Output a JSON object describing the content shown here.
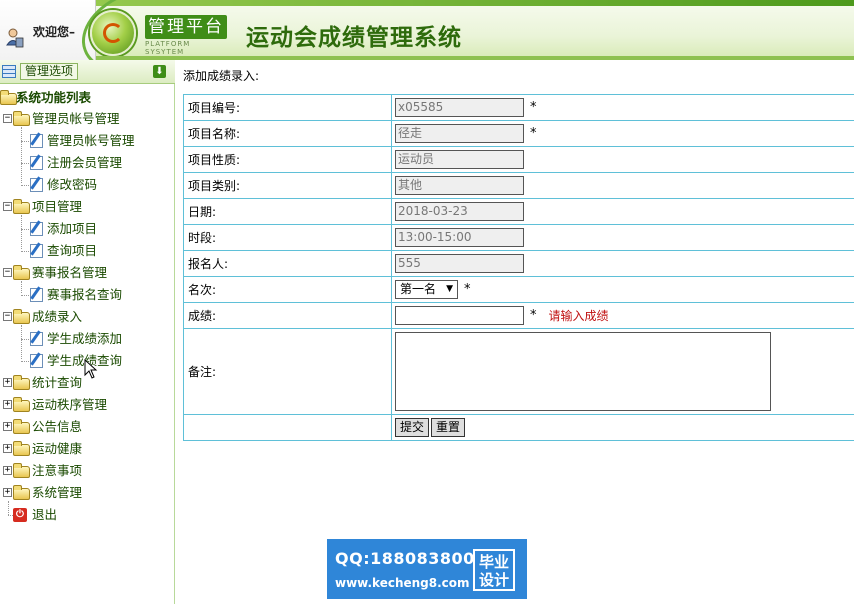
{
  "header": {
    "welcome": "欢迎您–",
    "badge_title": "管理平台",
    "badge_subtitle": "PLATFORM SYSYTEM",
    "system_title": "运动会成绩管理系统"
  },
  "sidebar": {
    "header_label": "管理选项",
    "tree_title": "系统功能列表",
    "groups": [
      {
        "label": "管理员帐号管理",
        "expanded": true,
        "items": [
          "管理员帐号管理",
          "注册会员管理",
          "修改密码"
        ]
      },
      {
        "label": "项目管理",
        "expanded": true,
        "items": [
          "添加项目",
          "查询项目"
        ]
      },
      {
        "label": "赛事报名管理",
        "expanded": true,
        "items": [
          "赛事报名查询"
        ]
      },
      {
        "label": "成绩录入",
        "expanded": true,
        "items": [
          "学生成绩添加",
          "学生成绩查询"
        ]
      },
      {
        "label": "统计查询",
        "expanded": false,
        "items": []
      },
      {
        "label": "运动秩序管理",
        "expanded": false,
        "items": []
      },
      {
        "label": "公告信息",
        "expanded": false,
        "items": []
      },
      {
        "label": "运动健康",
        "expanded": false,
        "items": []
      },
      {
        "label": "注意事项",
        "expanded": false,
        "items": []
      },
      {
        "label": "系统管理",
        "expanded": false,
        "items": []
      }
    ],
    "exit_label": "退出",
    "plus": "+",
    "minus": "−"
  },
  "main": {
    "section_title": "添加成绩录入:",
    "fields": {
      "project_id": {
        "label": "项目编号:",
        "value": "x05585",
        "required": "*"
      },
      "project_name": {
        "label": "项目名称:",
        "value": "径走",
        "required": "*"
      },
      "project_nature": {
        "label": "项目性质:",
        "value": "运动员"
      },
      "project_category": {
        "label": "项目类别:",
        "value": "其他"
      },
      "date": {
        "label": "日期:",
        "value": "2018-03-23"
      },
      "time_slot": {
        "label": "时段:",
        "value": "13:00-15:00"
      },
      "registrant": {
        "label": "报名人:",
        "value": "555"
      },
      "rank": {
        "label": "名次:",
        "value": "第一名",
        "required": "*"
      },
      "score": {
        "label": "成绩:",
        "value": "",
        "required": "*",
        "error": "请输入成绩"
      },
      "remark": {
        "label": "备注:",
        "value": ""
      }
    },
    "submit_label": "提交",
    "reset_label": "重置"
  },
  "watermark": {
    "qq": "QQ:188083800",
    "url": "www.kecheng8.com",
    "stamp_line1": "毕业",
    "stamp_line2": "设计"
  },
  "colors": {
    "brand_green": "#3f8d17",
    "title_green": "#2e6b0c",
    "table_border": "#5fc0d8",
    "error_red": "#c01010",
    "watermark_blue": "#2f86d8"
  }
}
